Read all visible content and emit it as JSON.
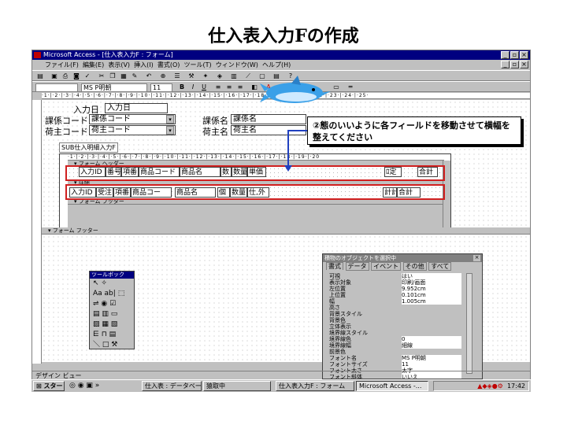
{
  "slide_title": "仕入表入力Fの作成",
  "window": {
    "title": "Microsoft Access - [仕入表入力F : フォーム]",
    "menu": [
      "ファイル(F)",
      "編集(E)",
      "表示(V)",
      "挿入(I)",
      "書式(O)",
      "ツール(T)",
      "ウィンドウ(W)",
      "ヘルプ(H)"
    ]
  },
  "toolbar": {
    "font": "MS P明朝",
    "size": "11"
  },
  "form": {
    "labels": {
      "input_date": "入力日",
      "dept_code": "課係コード",
      "supplier_code": "荷主コード",
      "dept_name": "課係名",
      "supplier_name": "荷主名"
    },
    "fields": {
      "input_date": "入力日",
      "dept_code": "課係コード",
      "supplier_code": "荷主コード",
      "dept_name": "課係名",
      "supplier_name": "荷主名"
    },
    "subform_label": "SUB仕入明細入力F",
    "form_footer_label": "フォーム フッター"
  },
  "subform": {
    "header_bar": "フォーム ヘッダー",
    "detail_bar": "詳細",
    "footer_bar": "フォーム フッター",
    "header_cells": [
      "入力ID",
      "番号",
      "項番",
      "商品コード",
      "商品名",
      "数",
      "数量",
      "単価",
      "ﾛ定",
      "合計"
    ],
    "detail_cells": [
      "入力ID",
      "受注",
      "項番",
      "商品コー",
      "商品名",
      "個",
      "数量",
      "仕,外",
      "計計",
      "合計"
    ]
  },
  "callout": {
    "text": "②態のいいように各フィールドを移動させて横幅を整えてください"
  },
  "toolbox": {
    "title": "ツールボック"
  },
  "property_sheet": {
    "title": "積物のオブジェクトを選択中",
    "tabs": [
      "書式",
      "データ",
      "イベント",
      "その他",
      "すべて"
    ],
    "rows": [
      [
        "可視",
        "はい"
      ],
      [
        "表示対象",
        "印刷/画面"
      ],
      [
        "左位置",
        "9.952cm"
      ],
      [
        "上位置",
        "0.101cm"
      ],
      [
        "幅",
        "1.005cm"
      ],
      [
        "高さ",
        ""
      ],
      [
        "背景スタイル",
        ""
      ],
      [
        "背景色",
        ""
      ],
      [
        "立体表示",
        ""
      ],
      [
        "境界線スタイル",
        ""
      ],
      [
        "境界線色",
        "0"
      ],
      [
        "境界線幅",
        "細線"
      ],
      [
        "前景色",
        ""
      ],
      [
        "フォント名",
        "MS P明朝"
      ],
      [
        "フォントサイズ",
        "11"
      ],
      [
        "フォント太さ",
        "太字"
      ],
      [
        "フォント斜体",
        "いいえ"
      ]
    ]
  },
  "statusbar": {
    "text": "デザイン ビュー"
  },
  "taskbar": {
    "start": "スタート",
    "tasks": [
      "仕入表 : データベース",
      "猿取中",
      "仕入表入力F : フォーム",
      "Microsoft Access -..."
    ],
    "clock": "17:42"
  }
}
